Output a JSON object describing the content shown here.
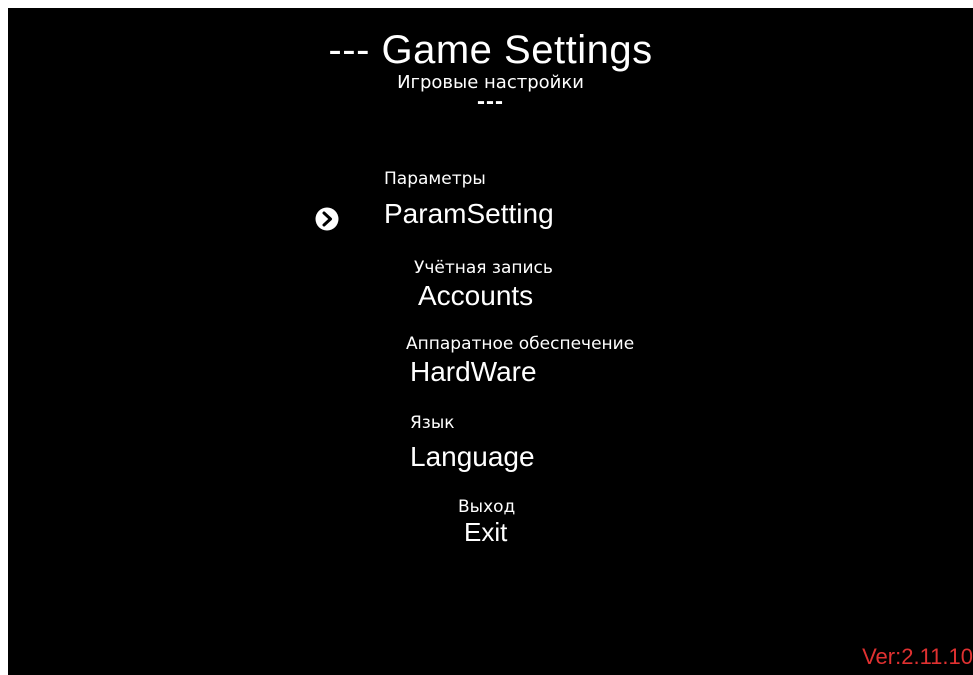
{
  "header": {
    "title": "--- Game Settings",
    "subtitle_ru": "Игровые настройки",
    "title_tail": "---"
  },
  "menu": {
    "selected_index": 0,
    "items": [
      {
        "ru": "Параметры",
        "en": "ParamSetting"
      },
      {
        "ru": "Учётная запись",
        "en": "Accounts"
      },
      {
        "ru": "Аппаратное обеспечение",
        "en": "HardWare"
      },
      {
        "ru": "Язык",
        "en": "Language"
      },
      {
        "ru": "Выход",
        "en": "Exit"
      }
    ]
  },
  "version": "Ver:2.11.10",
  "colors": {
    "background": "#000000",
    "text": "#ffffff",
    "version": "#e03131"
  },
  "icons": {
    "selector": "chevron-right-circle-icon"
  }
}
